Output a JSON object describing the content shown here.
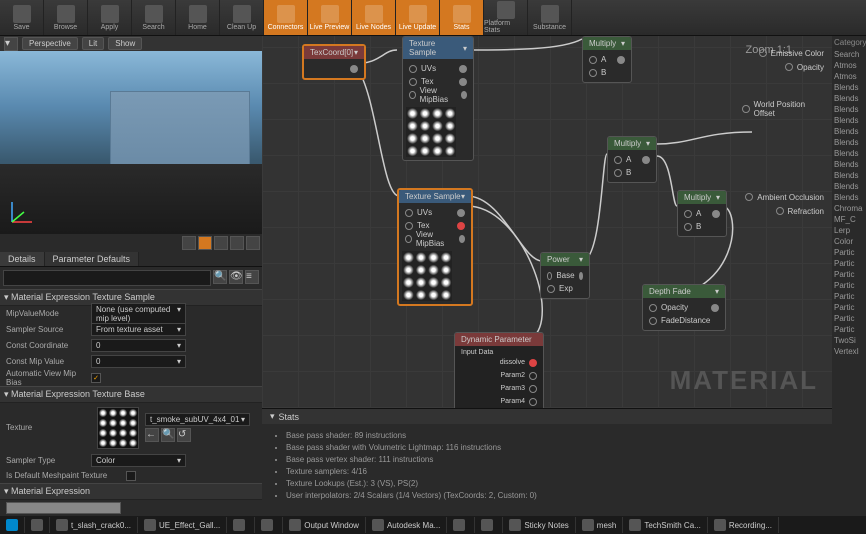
{
  "toolbar": [
    {
      "label": "Save",
      "active": false
    },
    {
      "label": "Browse",
      "active": false
    },
    {
      "label": "Apply",
      "active": false
    },
    {
      "label": "Search",
      "active": false
    },
    {
      "label": "Home",
      "active": false
    },
    {
      "label": "Clean Up",
      "active": false
    },
    {
      "label": "Connectors",
      "active": true
    },
    {
      "label": "Live Preview",
      "active": true
    },
    {
      "label": "Live Nodes",
      "active": true
    },
    {
      "label": "Live Update",
      "active": true
    },
    {
      "label": "Stats",
      "active": true
    },
    {
      "label": "Platform Stats",
      "active": false
    },
    {
      "label": "Substance",
      "active": false
    }
  ],
  "viewport": {
    "perspective": "Perspective",
    "lit": "Lit",
    "show": "Show"
  },
  "details": {
    "tab1": "Details",
    "tab2": "Parameter Defaults",
    "sections": {
      "a": "Material Expression Texture Sample",
      "b": "Material Expression Texture Base",
      "c": "Material Expression"
    },
    "props": {
      "mipValueMode": {
        "label": "MipValueMode",
        "value": "None (use computed mip level)"
      },
      "samplerSource": {
        "label": "Sampler Source",
        "value": "From texture asset"
      },
      "constCoord": {
        "label": "Const Coordinate",
        "value": "0"
      },
      "constMip": {
        "label": "Const Mip Value",
        "value": "0"
      },
      "autoMip": {
        "label": "Automatic View Mip Bias"
      },
      "texture": {
        "label": "Texture",
        "value": "t_smoke_subUV_4x4_01"
      },
      "samplerType": {
        "label": "Sampler Type",
        "value": "Color"
      },
      "isDefault": {
        "label": "Is Default Meshpaint Texture"
      }
    }
  },
  "graph": {
    "zoom": "Zoom 1:1",
    "watermark": "MATERIAL",
    "nodes": {
      "texcoord": "TexCoord[0]",
      "texsample1": "Texture Sample",
      "texsample2": "Texture Sample",
      "mult1": "Multiply",
      "mult2": "Multiply",
      "mult3": "Multiply",
      "power": "Power",
      "depthfade": "Depth Fade",
      "dynparam": "Dynamic Parameter"
    },
    "pins": {
      "uvs": "UVs",
      "tex": "Tex",
      "viewMip": "View MipBias",
      "a": "A",
      "b": "B",
      "base": "Base",
      "exp": "Exp",
      "opacity": "Opacity",
      "fadedist": "FadeDistance",
      "inputData": "Input Data",
      "dissolve": "dissolve",
      "param2": "Param2",
      "param3": "Param3",
      "param4": "Param4"
    },
    "material_outputs": [
      {
        "label": "Emissive Color",
        "active": true
      },
      {
        "label": "Opacity",
        "active": true
      },
      {
        "label": "World Position Offset",
        "active": true
      },
      {
        "label": "Ambient Occlusion",
        "active": true
      },
      {
        "label": "Refraction",
        "active": true
      }
    ]
  },
  "stats": {
    "title": "Stats",
    "lines": [
      "Base pass shader: 89 instructions",
      "Base pass shader with Volumetric Lightmap: 116 instructions",
      "Base pass vertex shader: 111 instructions",
      "Texture samplers: 4/16",
      "Texture Lookups (Est.): 3 (VS), PS(2)",
      "User interpolators: 2/4 Scalars (1/4 Vectors) (TexCoords: 2, Custom: 0)"
    ]
  },
  "palette": {
    "header": "Category",
    "search": "Search",
    "items": [
      "Atmos",
      "Atmos",
      "Blends",
      "Blends",
      "Blends",
      "Blends",
      "Blends",
      "Blends",
      "Blends",
      "Blends",
      "Blends",
      "Blends",
      "Blends",
      "Chroma",
      "MF_C",
      "Lerp",
      "Color",
      "Partic",
      "Partic",
      "Partic",
      "Partic",
      "Partic",
      "Partic",
      "Partic",
      "Partic",
      "TwoSi",
      "VertexI"
    ]
  },
  "taskbar": [
    "t_slash_crack0...",
    "UE_Effect_Gall...",
    "",
    "",
    "Output Window",
    "Autodesk Ma...",
    "",
    "",
    "Sticky Notes",
    "mesh",
    "TechSmith Ca...",
    "Recording..."
  ]
}
